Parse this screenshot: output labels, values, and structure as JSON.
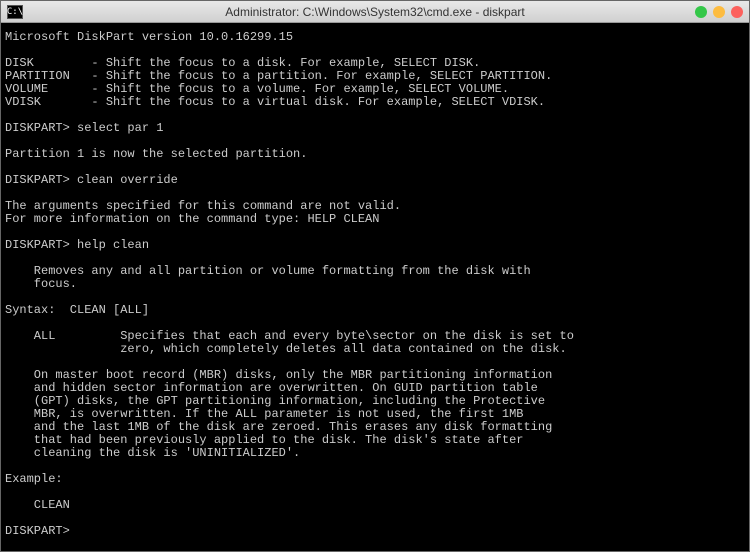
{
  "window": {
    "title": "Administrator: C:\\Windows\\System32\\cmd.exe - diskpart",
    "icon_label": "C:\\"
  },
  "terminal": {
    "lines": [
      "Microsoft DiskPart version 10.0.16299.15",
      "",
      "DISK        - Shift the focus to a disk. For example, SELECT DISK.",
      "PARTITION   - Shift the focus to a partition. For example, SELECT PARTITION.",
      "VOLUME      - Shift the focus to a volume. For example, SELECT VOLUME.",
      "VDISK       - Shift the focus to a virtual disk. For example, SELECT VDISK.",
      "",
      "DISKPART> select par 1",
      "",
      "Partition 1 is now the selected partition.",
      "",
      "DISKPART> clean override",
      "",
      "The arguments specified for this command are not valid.",
      "For more information on the command type: HELP CLEAN",
      "",
      "DISKPART> help clean",
      "",
      "    Removes any and all partition or volume formatting from the disk with",
      "    focus.",
      "",
      "Syntax:  CLEAN [ALL]",
      "",
      "    ALL         Specifies that each and every byte\\sector on the disk is set to",
      "                zero, which completely deletes all data contained on the disk.",
      "",
      "    On master boot record (MBR) disks, only the MBR partitioning information",
      "    and hidden sector information are overwritten. On GUID partition table",
      "    (GPT) disks, the GPT partitioning information, including the Protective",
      "    MBR, is overwritten. If the ALL parameter is not used, the first 1MB",
      "    and the last 1MB of the disk are zeroed. This erases any disk formatting",
      "    that had been previously applied to the disk. The disk's state after",
      "    cleaning the disk is 'UNINITIALIZED'.",
      "",
      "Example:",
      "",
      "    CLEAN",
      "",
      "DISKPART>"
    ]
  }
}
